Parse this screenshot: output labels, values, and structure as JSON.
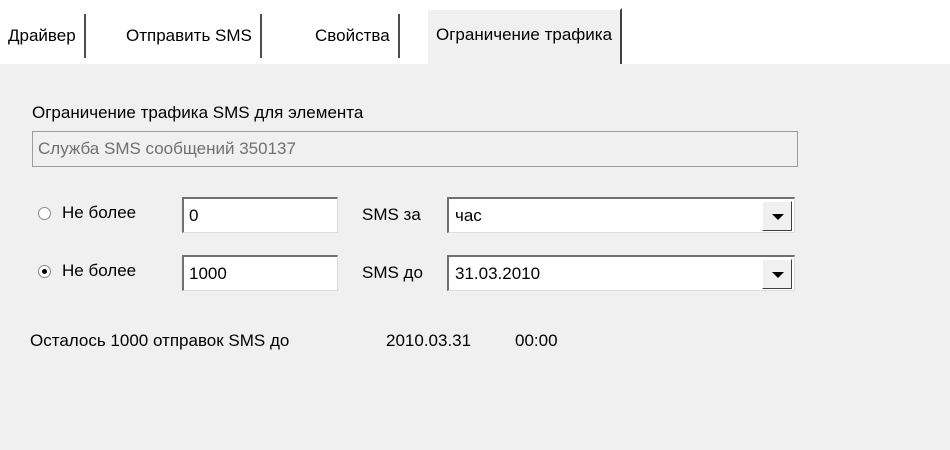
{
  "tabs": [
    {
      "label": "Драйвер"
    },
    {
      "label": "Отправить SMS"
    },
    {
      "label": "Свойства"
    },
    {
      "label": "Ограничение трафика"
    }
  ],
  "panel": {
    "heading": "Ограничение трафика SMS для элемента",
    "element_name": "Служба SMS сообщений 350137",
    "limit_period": {
      "radio_label": "Не более",
      "selected": false,
      "count_value": "0",
      "unit_label": "SMS за",
      "period_value": "час"
    },
    "limit_date": {
      "radio_label": "Не более",
      "selected": true,
      "count_value": "1000",
      "unit_label": "SMS до",
      "date_value": "31.03.2010"
    },
    "status_prefix": "Осталось 1000 отправок SMS до",
    "status_date": "2010.03.31",
    "status_time": "00:00"
  }
}
